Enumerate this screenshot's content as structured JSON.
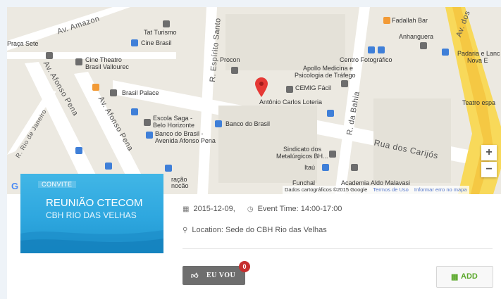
{
  "map": {
    "streets": {
      "av_amazonas": "Av. Amazon",
      "av_afonso_pena_left": "Av. Afonso Pena",
      "av_afonso_pena_center": "Av. Afonso Pena",
      "r_espirito_santo": "R. Espírito Santo",
      "r_rio_de_janeiro": "R. Rio de Janeiro",
      "r_da_bahia": "R. da Bahia",
      "rua_dos_carijos": "Rua dos Carijós",
      "av_dos": "Av. dos"
    },
    "places": {
      "tat_turismo": "Tat Turismo",
      "cine_brasil": "Cine Brasil",
      "praca_sete": "Praça Sete",
      "cine_theatro_1": "Cine Theatro",
      "cine_theatro_2": "Brasil Vallourec",
      "procon": "Procon",
      "fadallah": "Fadallah Bar",
      "anhanguera": "Anhanguera",
      "centro_fotografico": "Centro Fotográfico",
      "padaria_1": "Padaria e Lanc",
      "padaria_2": "Nova E",
      "apollo_1": "Apollo Medicina e",
      "apollo_2": "Psicologia de Tráfego",
      "cemig": "CEMIG Fácil",
      "brasil_palace": "Brasil Palace",
      "antonio_carlos": "Antônio Carlos Loteria",
      "teatro": "Teatro espa",
      "escola_saga_1": "Escola Saga -",
      "escola_saga_2": "Belo Horizonte",
      "banco_brasil": "Banco do Brasil",
      "banco_brasil_av_1": "Banco do Brasil -",
      "banco_brasil_av_2": "Avenida Afonso Pena",
      "sindicato_1": "Sindicato dos",
      "sindicato_2": "Metalúrgicos BH...",
      "itau": "Itaú",
      "funchal": "Funchal",
      "academia": "Academia Aldo Malavasi",
      "ao_1": "ração",
      "ao_2": "nocão"
    },
    "zoom_in": "+",
    "zoom_out": "−",
    "google": "G",
    "attribution": "Dados cartográficos ©2015 Google",
    "terms": "Termos de Uso",
    "report": "Informar erro no mapa"
  },
  "event": {
    "thumb_tag": "CONVITE",
    "thumb_title": "REUNIÃO CTECOM",
    "thumb_subtitle": "CBH RIO DAS VELHAS",
    "date": "2015-12-09,",
    "time": "Event Time: 14:00-17:00",
    "location": "Location: Sede do CBH Rio das Velhas",
    "attend_label": "EU VOU",
    "attend_count": "0",
    "add_label": "ADD"
  }
}
